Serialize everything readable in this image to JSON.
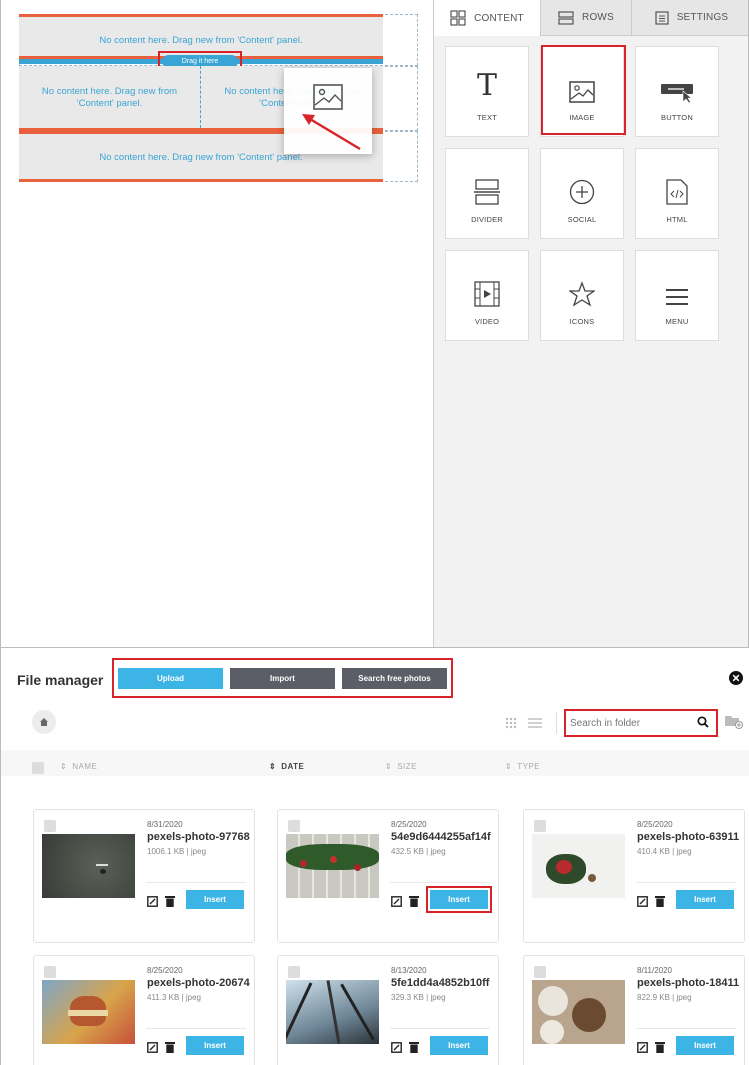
{
  "editor": {
    "placeholder_full": "No content here. Drag new from 'Content' panel.",
    "placeholder_left": "No content here. Drag new from 'Content' panel.",
    "placeholder_right_visible": "No content here. Drag new from 'Content' panel.",
    "drag_pill": "Drag it here"
  },
  "tabs": [
    {
      "label": "CONTENT",
      "icon": "grid-icon"
    },
    {
      "label": "ROWS",
      "icon": "rows-icon"
    },
    {
      "label": "SETTINGS",
      "icon": "settings-icon"
    }
  ],
  "blocks": [
    {
      "label": "TEXT",
      "icon": "text-icon"
    },
    {
      "label": "IMAGE",
      "icon": "image-icon"
    },
    {
      "label": "BUTTON",
      "icon": "button-icon"
    },
    {
      "label": "DIVIDER",
      "icon": "divider-icon"
    },
    {
      "label": "SOCIAL",
      "icon": "social-icon"
    },
    {
      "label": "HTML",
      "icon": "html-icon"
    },
    {
      "label": "VIDEO",
      "icon": "video-icon"
    },
    {
      "label": "ICONS",
      "icon": "star-icon"
    },
    {
      "label": "MENU",
      "icon": "menu-icon"
    }
  ],
  "file_manager": {
    "title": "File manager",
    "upload_label": "Upload",
    "import_label": "Import",
    "search_photos_label": "Search free photos",
    "search_placeholder": "Search in folder",
    "columns": [
      "NAME",
      "DATE",
      "SIZE",
      "TYPE"
    ],
    "files": [
      {
        "date": "8/31/2020",
        "name": "pexels-photo-97768",
        "size": "1006.1 KB",
        "type": "jpeg",
        "insert": "Insert"
      },
      {
        "date": "8/25/2020",
        "name": "54e9d6444255af14f",
        "size": "432.5 KB",
        "type": "jpeg",
        "insert": "Insert"
      },
      {
        "date": "8/25/2020",
        "name": "pexels-photo-63911",
        "size": "410.4 KB",
        "type": "jpeg",
        "insert": "Insert"
      },
      {
        "date": "8/25/2020",
        "name": "pexels-photo-20674",
        "size": "411.3 KB",
        "type": "jpeg",
        "insert": "Insert"
      },
      {
        "date": "8/13/2020",
        "name": "5fe1dd4a4852b10ff",
        "size": "329.3 KB",
        "type": "jpeg",
        "insert": "Insert"
      },
      {
        "date": "8/11/2020",
        "name": "pexels-photo-18411",
        "size": "822.9 KB",
        "type": "jpeg",
        "insert": "Insert"
      }
    ]
  },
  "colors": {
    "accent": "#3aa5d4",
    "row_border": "#e8613c",
    "highlight": "#d8232a",
    "insert": "#3db4e6",
    "dark_button": "#5b5e66"
  }
}
